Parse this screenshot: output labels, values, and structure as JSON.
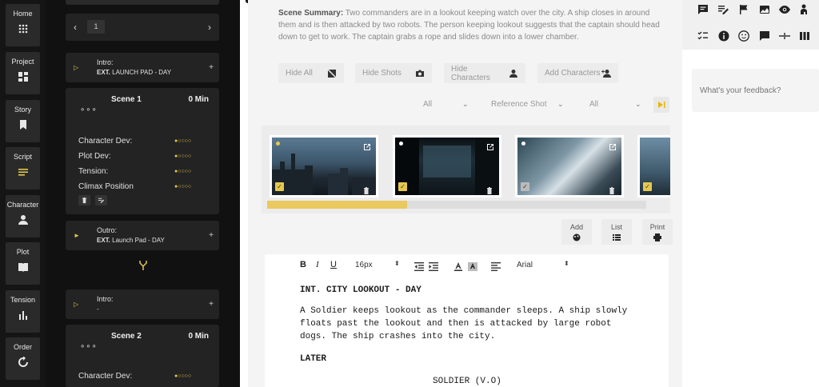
{
  "nav": [
    {
      "label": "Home",
      "icon": "grid-dots-icon"
    },
    {
      "label": "Project",
      "icon": "dashboard-icon"
    },
    {
      "label": "Story",
      "icon": "bookmark-icon"
    },
    {
      "label": "Script",
      "icon": "lines-icon"
    },
    {
      "label": "Character",
      "icon": "person-icon"
    },
    {
      "label": "Plot",
      "icon": "book-icon"
    },
    {
      "label": "Tension",
      "icon": "bar-chart-icon"
    },
    {
      "label": "Order",
      "icon": "cycle-icon"
    }
  ],
  "scene_panel": {
    "page_number": "1",
    "prev_arrow": "‹",
    "next_arrow": "›",
    "beat1": {
      "title": "Intro:",
      "sub_prefix": "EXT.",
      "sub_text": " LAUNCH PAD - DAY",
      "plus": "+"
    },
    "scene1": {
      "title": "Scene 1",
      "minutes": "0 Min",
      "dots": "∘∘∘",
      "metrics": [
        {
          "label": "Character Dev:",
          "rating": 1
        },
        {
          "label": "Plot Dev:",
          "rating": 1
        },
        {
          "label": "Tension:",
          "rating": 1
        },
        {
          "label": "Climax Position",
          "rating": 1
        }
      ]
    },
    "beat2": {
      "title": "Outro:",
      "sub_prefix": "EXT.",
      "sub_text": "  Launch Pad - DAY",
      "plus": "+"
    },
    "beat3": {
      "title": "Intro:",
      "sub_text": "-",
      "plus": "+"
    },
    "scene2": {
      "title": "Scene 2",
      "minutes": "0 Min",
      "dots": "∘∘∘",
      "metrics": [
        {
          "label": "Character Dev:",
          "rating": 1
        }
      ]
    }
  },
  "main": {
    "summary_label": "Scene Summary:",
    "summary_text": " Two commanders are in a lookout keeping watch over the city. A ship closes in around them and is then attacked by two robots. The person keeping lookout suggests that the captain should head down to get to work. The captain grabs a rope and slides down into a lower chamber.",
    "toolbar": {
      "hide_all": "Hide All",
      "hide_shots": "Hide Shots",
      "hide_characters": "Hide Characters",
      "add_characters": "Add Characters"
    },
    "filters": {
      "f1": "All",
      "f2": "Reference Shot",
      "f3": "All"
    },
    "shots_progress": 0.37,
    "actions": {
      "add": "Add",
      "list": "List",
      "print": "Print"
    },
    "editor": {
      "bold": "B",
      "italic": "I",
      "underline": "U",
      "font_size": "16px",
      "font_family": "Arial",
      "updown": "⬍",
      "lines": [
        {
          "text": "INT. CITY LOOKOUT - DAY",
          "kind": "heading"
        },
        {
          "text": "A Soldier keeps lookout as the commander sleeps. A ship slowly",
          "kind": "action"
        },
        {
          "text": "floats past the lookout and then is attacked by large robot",
          "kind": "action"
        },
        {
          "text": "dogs. The ship crashes into the city.",
          "kind": "action"
        },
        {
          "text": "LATER",
          "kind": "heading"
        },
        {
          "text": "SOLDIER (V.O)",
          "kind": "character"
        }
      ]
    }
  },
  "right_panel": {
    "feedback_placeholder": "What's your feedback?"
  },
  "colors": {
    "accent": "#e6c84d",
    "dark": "#111111",
    "panel": "#232323"
  }
}
